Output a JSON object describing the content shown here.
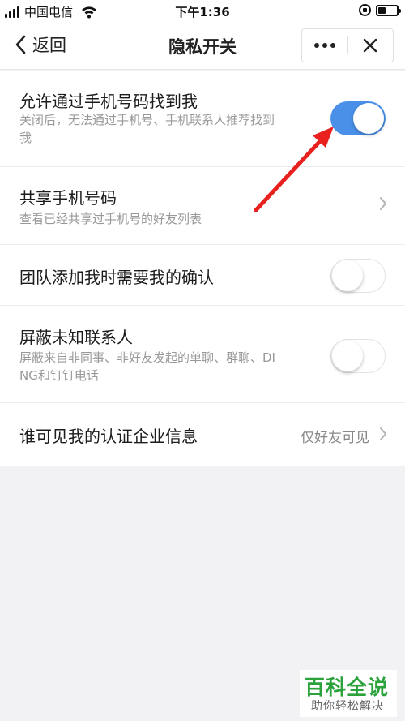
{
  "status_bar": {
    "carrier": "中国电信",
    "time": "下午1:36",
    "icons": [
      "signal-icon",
      "wifi-icon",
      "orientation-lock-icon",
      "battery-icon"
    ]
  },
  "navbar": {
    "back_label": "返回",
    "title": "隐私开关",
    "more_icon": "more-dots-icon",
    "close_icon": "close-icon"
  },
  "settings": [
    {
      "title": "允许通过手机号码找到我",
      "desc_line1": "关闭后，无法通过手机号、手机联系人推荐找到",
      "desc_line2": "我",
      "toggle": "on"
    },
    {
      "title": "共享手机号码",
      "desc": "查看已经共享过手机号的好友列表",
      "control": "chevron-right-icon"
    },
    {
      "title": "团队添加我时需要我的确认",
      "toggle": "off"
    },
    {
      "title": "屏蔽未知联系人",
      "desc_line1": "屏蔽来自非同事、非好友发起的单聊、群聊、DI",
      "desc_line2": "NG和钉钉电话",
      "toggle": "off"
    },
    {
      "title": "谁可见我的认证企业信息",
      "value": "仅好友可见",
      "control": "chevron-right-icon"
    }
  ],
  "annotation": {
    "arrow_color": "#e8201e"
  },
  "watermark": {
    "main": "百科全说",
    "sub": "助你轻松解决"
  },
  "colors": {
    "accent": "#4a90e8",
    "background": "#f2f2f4",
    "watermark_green": "#2ba23c"
  }
}
